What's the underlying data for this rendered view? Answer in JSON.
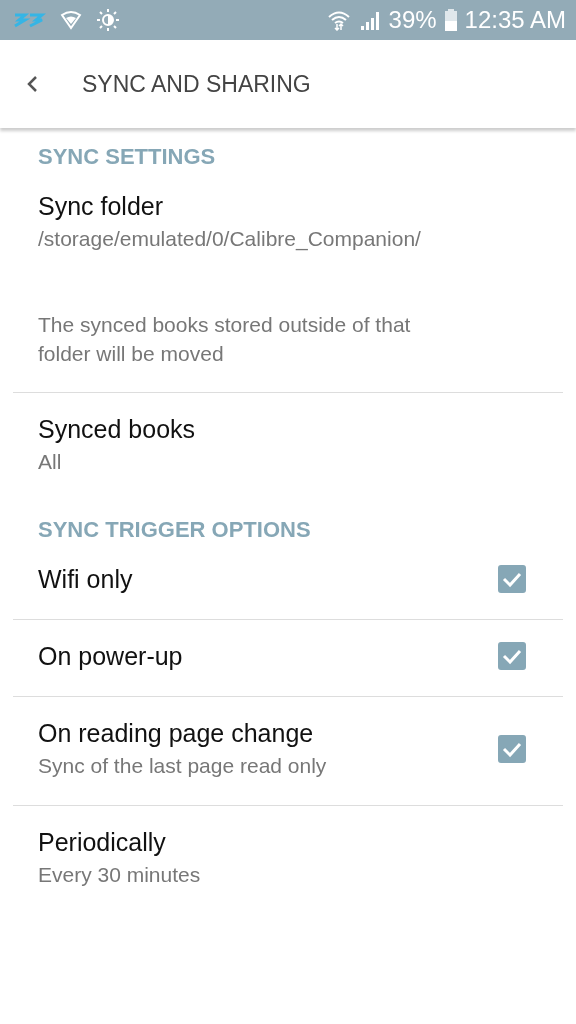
{
  "status_bar": {
    "battery": "39%",
    "time": "12:35 AM"
  },
  "app_bar": {
    "title": "SYNC AND SHARING"
  },
  "sections": [
    {
      "header": "SYNC SETTINGS",
      "items": [
        {
          "kind": "preference",
          "title": "Sync folder",
          "summary": "/storage/emulated/0/Calibre_Companion/",
          "note": "The synced books stored outside of that folder will be moved"
        },
        {
          "kind": "preference",
          "title": "Synced books",
          "summary": "All"
        }
      ]
    },
    {
      "header": "SYNC TRIGGER OPTIONS",
      "items": [
        {
          "kind": "checkbox",
          "title": "Wifi only",
          "checked": true
        },
        {
          "kind": "checkbox",
          "title": "On power-up",
          "checked": true
        },
        {
          "kind": "checkbox",
          "title": "On reading page change",
          "summary": "Sync of the last page read only",
          "checked": true
        },
        {
          "kind": "preference",
          "title": "Periodically",
          "summary": "Every 30 minutes"
        }
      ]
    }
  ]
}
